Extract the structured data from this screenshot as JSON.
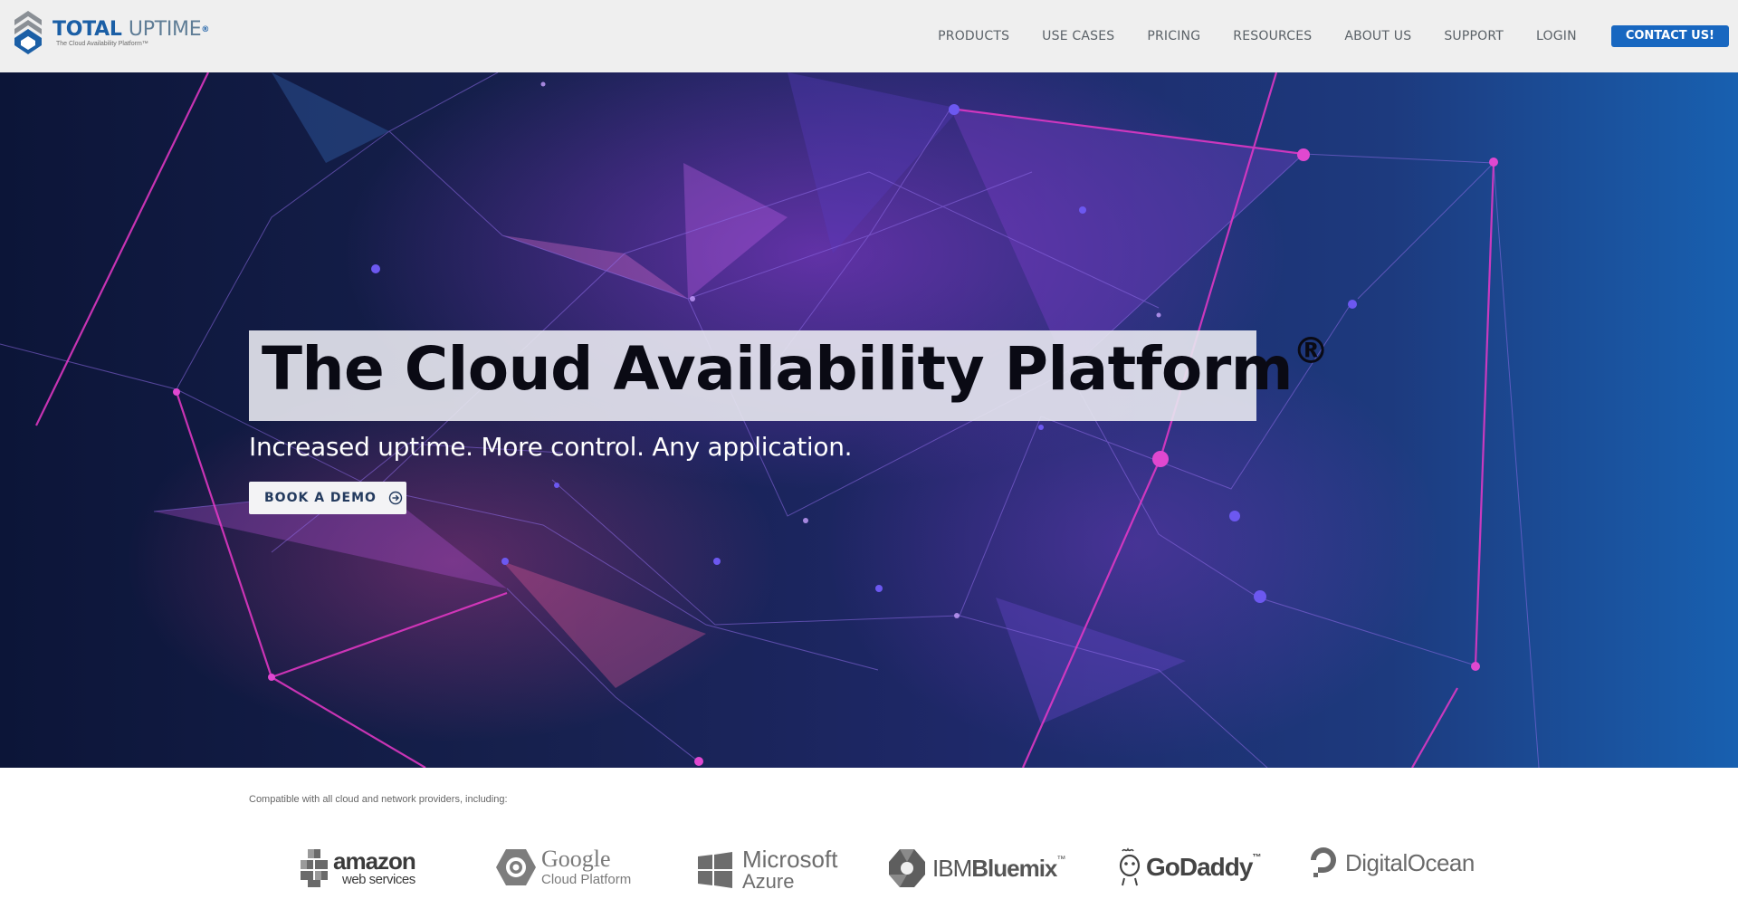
{
  "header": {
    "logo": {
      "name_bold": "TOTAL",
      "name_light": "UPTIME",
      "trademark": "®",
      "tagline": "The Cloud Availability Platform™",
      "icon": "total-uptime-logo-icon"
    },
    "nav": [
      {
        "label": "PRODUCTS"
      },
      {
        "label": "USE CASES"
      },
      {
        "label": "PRICING"
      },
      {
        "label": "RESOURCES"
      },
      {
        "label": "ABOUT US"
      },
      {
        "label": "SUPPORT"
      },
      {
        "label": "LOGIN"
      }
    ],
    "contact_label": "CONTACT US!"
  },
  "hero": {
    "title": "The Cloud Availability Platform",
    "title_mark": "®",
    "subtitle": "Increased uptime. More control. Any application.",
    "cta_label": "BOOK A DEMO",
    "cta_icon": "arrow-right-circle-icon",
    "background": "network-polygon-graphic"
  },
  "partners": {
    "intro": "Compatible with all cloud and network providers, including:",
    "aws": {
      "line1": "amazon",
      "line2": "web services"
    },
    "google": {
      "line1": "Google",
      "line2": "Cloud Platform"
    },
    "azure": {
      "line1": "Microsoft",
      "line2": "Azure"
    },
    "ibm": {
      "prefix": "IBM",
      "name": "Bluemix",
      "mark": "™"
    },
    "godaddy": {
      "name": "GoDaddy",
      "mark": "™"
    },
    "digitalocean": {
      "name": "DigitalOcean"
    }
  },
  "colors": {
    "header_bg": "#efefef",
    "brand_blue": "#1b5fa6",
    "contact_bg": "#1867c0",
    "hero_dark": "#0c1538",
    "hero_light": "#1860b0",
    "accent_pink": "#e03cc8",
    "accent_violet": "#7a4be0"
  }
}
